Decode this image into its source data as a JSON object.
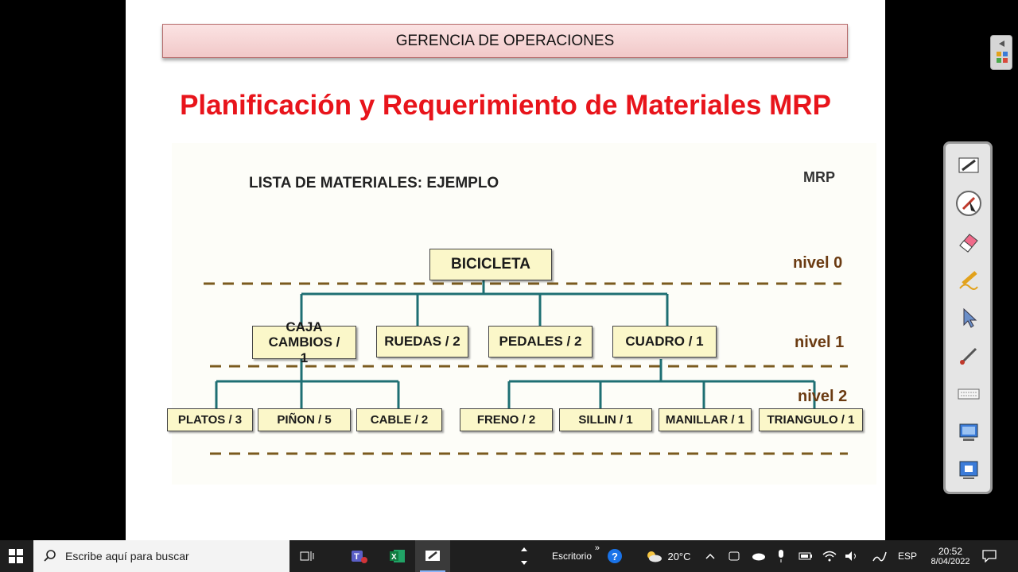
{
  "slide": {
    "header": "GERENCIA DE OPERACIONES",
    "title": "Planificación y Requerimiento de Materiales MRP",
    "subtitle": "LISTA DE MATERIALES: EJEMPLO",
    "mrp_tag": "MRP",
    "levels": [
      "nivel 0",
      "nivel 1",
      "nivel 2"
    ],
    "root": "BICICLETA",
    "level1": [
      {
        "label": "CAJA CAMBIOS / 1"
      },
      {
        "label": "RUEDAS / 2"
      },
      {
        "label": "PEDALES / 2"
      },
      {
        "label": "CUADRO / 1"
      }
    ],
    "level2": [
      {
        "label": "PLATOS / 3"
      },
      {
        "label": "PIÑON / 5"
      },
      {
        "label": "CABLE / 2"
      },
      {
        "label": "FRENO / 2"
      },
      {
        "label": "SILLIN / 1"
      },
      {
        "label": "MANILLAR / 1"
      },
      {
        "label": "TRIANGULO / 1"
      }
    ],
    "colors": {
      "title": "#e8141b",
      "connector": "#1e6f73",
      "level_line": "#7a5a1e",
      "node_fill": "#fbf7c9"
    }
  },
  "toolbar": {
    "tools": [
      "pen-icon",
      "laser-pointer-icon",
      "eraser-icon",
      "highlighter-icon",
      "cursor-icon",
      "brush-icon",
      "keyboard-icon",
      "screen-capture-icon",
      "whiteboard-icon"
    ]
  },
  "taskbar": {
    "search_placeholder": "Escribe aquí para buscar",
    "desktop_label": "Escritorio",
    "temperature": "20°C",
    "language": "ESP",
    "time": "20:52",
    "date": "8/04/2022"
  }
}
